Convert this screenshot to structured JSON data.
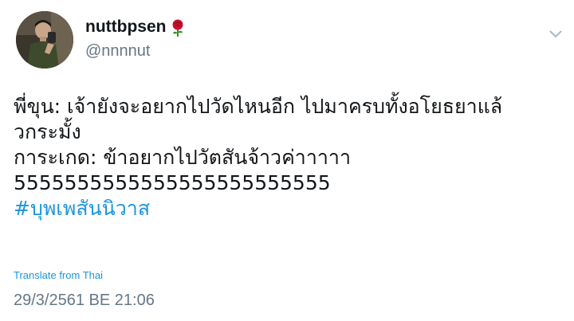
{
  "author": {
    "display_name": "nuttbpsen",
    "handle": "@nnnnut",
    "avatar_icon": "profile-photo",
    "badge_icon": "rose-icon"
  },
  "tweet": {
    "lines": [
      "พี่ขุน: เจ้ายังจะอยากไปวัดไหนอีก ไปมาครบทั้งอโยธยาแล้",
      "วกระมั้ง",
      "การะเกด: ข้าอยากไปวัตสันจ้าวค่าาาาา",
      "5555555555555555555555555"
    ],
    "hashtag": "#บุพเพสันนิวาส",
    "translate_label": "Translate from Thai",
    "timestamp": "29/3/2561 BE 21:06"
  },
  "menu_icon": "chevron-down-icon",
  "colors": {
    "link": "#1b95e0",
    "secondary_text": "#657786",
    "primary_text": "#14171a",
    "rose": "#c8102e"
  }
}
